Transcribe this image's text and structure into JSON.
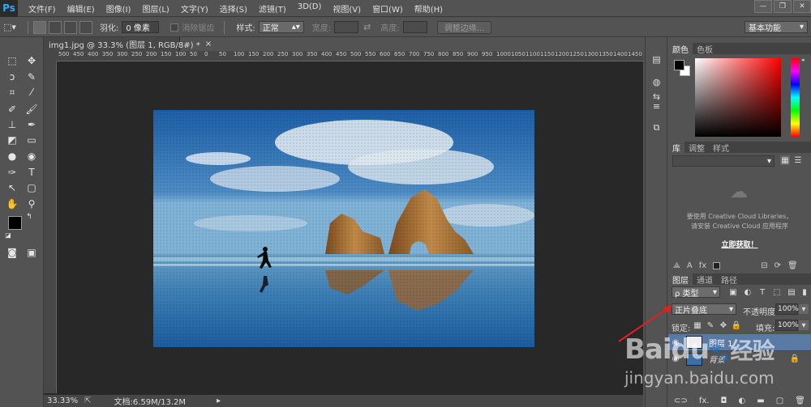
{
  "app": {
    "logo": "Ps"
  },
  "menu": {
    "items": [
      "文件(F)",
      "编辑(E)",
      "图像(I)",
      "图层(L)",
      "文字(Y)",
      "选择(S)",
      "滤镜(T)",
      "3D(D)",
      "视图(V)",
      "窗口(W)",
      "帮助(H)"
    ]
  },
  "window_controls": {
    "minimize": "—",
    "restore": "❐",
    "close": "✕"
  },
  "options": {
    "feather_label": "羽化:",
    "feather_value": "0 像素",
    "antialias_label": "消除锯齿",
    "style_label": "样式:",
    "style_value": "正常",
    "width_label": "宽度:",
    "height_label": "高度:",
    "refine_edge": "调整边缘...",
    "workspace": "基本功能"
  },
  "document": {
    "tab_title": "img1.jpg @ 33.3% (图层 1, RGB/8#) *",
    "tab_close": "×",
    "ruler_top": [
      "500",
      "450",
      "400",
      "350",
      "300",
      "250",
      "200",
      "150",
      "100",
      "50",
      "0",
      "50",
      "100",
      "150",
      "200",
      "250",
      "300",
      "350",
      "400",
      "450",
      "500",
      "550",
      "600",
      "650",
      "700",
      "750",
      "800",
      "850",
      "900",
      "950",
      "1000",
      "1050",
      "1100",
      "1150",
      "1200",
      "1250",
      "1300",
      "1350",
      "1400",
      "1450",
      "150"
    ]
  },
  "status": {
    "zoom": "33.33%",
    "doc_info": "文档:6.59M/13.2M"
  },
  "color_panel": {
    "tabs": [
      "颜色",
      "色板"
    ],
    "colors": {
      "gradient_hue": "#ff0000"
    }
  },
  "library_panel": {
    "tabs": [
      "库",
      "调整",
      "样式"
    ],
    "message_line1": "要使用 Creative Cloud Libraries，",
    "message_line2": "请安装 Creative Cloud 应用程序",
    "install_link": "立即获取！"
  },
  "layers_panel": {
    "tabs": [
      "图层",
      "通道",
      "路径"
    ],
    "filter_kind": "ρ 类型",
    "blend_mode": "正片叠底",
    "opacity_label": "不透明度:",
    "opacity_value": "100%",
    "lock_label": "锁定:",
    "fill_label": "填充:",
    "fill_value": "100%",
    "layers": [
      {
        "name": "图层 1",
        "selected": true
      },
      {
        "name": "背景",
        "locked": true
      }
    ]
  },
  "watermark": {
    "brand": "Baidu",
    "brand_cn": "经验",
    "url": "jingyan.baidu.com"
  }
}
